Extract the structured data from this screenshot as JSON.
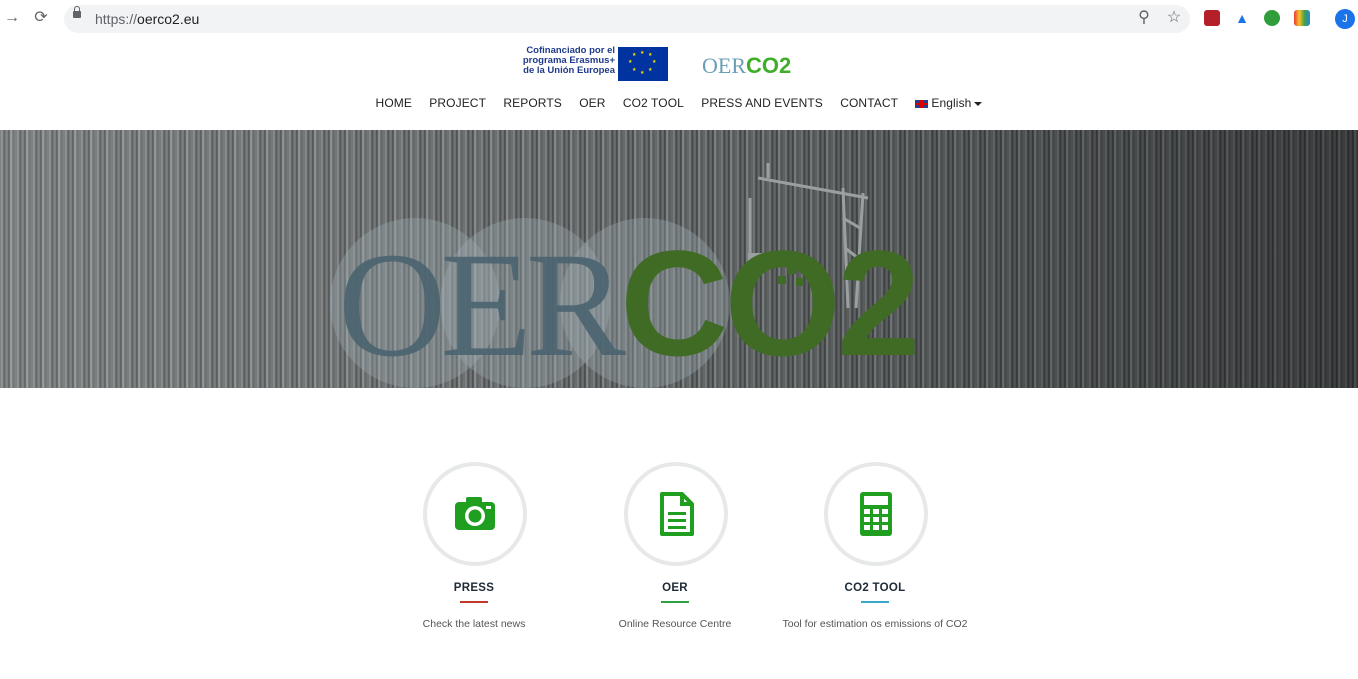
{
  "browser": {
    "url_host": "oerco2.eu",
    "url_scheme": "https://",
    "profile_initial": "J"
  },
  "header": {
    "eu_text": "Cofinanciado por el programa Erasmus+ de la Unión Europea",
    "site_logo_oer": "OER",
    "site_logo_co2": "CO2"
  },
  "menu": {
    "items": [
      "HOME",
      "PROJECT",
      "REPORTS",
      "OER",
      "CO2 TOOL",
      "PRESS AND EVENTS",
      "CONTACT"
    ],
    "language": "English"
  },
  "hero": {
    "oer": "OER",
    "co2": "CO2"
  },
  "features": [
    {
      "title": "PRESS",
      "description": "Check the latest news",
      "icon": "camera-icon",
      "accent": "#c0392b"
    },
    {
      "title": "OER",
      "description": "Online Resource Centre",
      "icon": "document-icon",
      "accent": "#2ea043"
    },
    {
      "title": "CO2 TOOL",
      "description": "Tool for estimation os emissions of CO2",
      "icon": "calculator-icon",
      "accent": "#3aa8c9"
    }
  ],
  "colors": {
    "icon_green": "#1f9e1f",
    "logo_green": "#3fae2a",
    "logo_blue": "#6a9fb5"
  }
}
